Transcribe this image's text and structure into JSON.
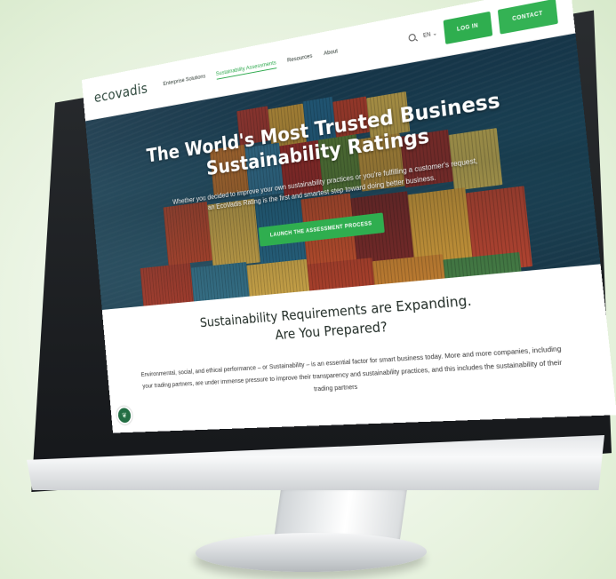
{
  "nav": {
    "logo": "ecovadis",
    "links": [
      {
        "label": "Enterprise Solutions",
        "active": false
      },
      {
        "label": "Sustainability Assessments",
        "active": true
      },
      {
        "label": "Resources",
        "active": false
      },
      {
        "label": "About",
        "active": false
      }
    ],
    "language": "EN",
    "login_label": "LOG IN",
    "contact_label": "CONTACT"
  },
  "hero": {
    "title_line1": "The World's Most Trusted Business",
    "title_line2": "Sustainability Ratings",
    "subtitle": "Whether you decided to improve your own sustainability practices or you're fulfilling a customer's request, an EcoVadis Rating is the first and smartest step toward doing better business.",
    "cta_label": "LAUNCH THE ASSESSMENT PROCESS"
  },
  "section": {
    "title_line1": "Sustainability Requirements are Expanding.",
    "title_line2": "Are You Prepared?",
    "body": "Environmental, social, and ethical performance – or Sustainability – is an essential factor for smart business today. More and more companies, including your trading partners, are under immense pressure to improve their transparency and sustainability practices, and this includes the sustainability of their trading partners"
  },
  "colors": {
    "brand_green": "#2fae4f",
    "logo_dark": "#1f3b2f",
    "background_tint": "#e3f0d9"
  },
  "icons": {
    "search": "search-icon",
    "language_chevron": "chevron-down-icon",
    "chat_badge": "leaf-chat-icon"
  }
}
